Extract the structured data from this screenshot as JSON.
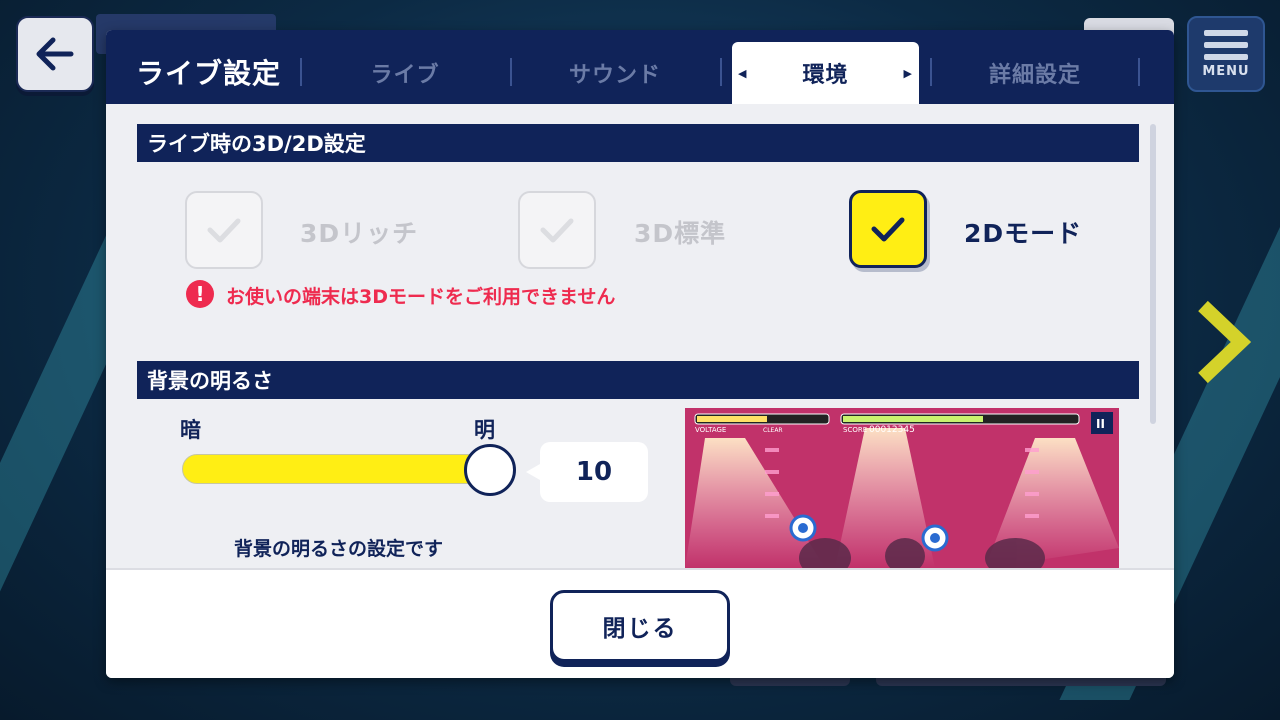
{
  "header": {
    "title": "ライブ設定",
    "tabs": [
      {
        "label": "ライブ",
        "active": false
      },
      {
        "label": "サウンド",
        "active": false
      },
      {
        "label": "環境",
        "active": true
      },
      {
        "label": "詳細設定",
        "active": false
      }
    ],
    "active_tab_left_arrow": "◀",
    "active_tab_right_arrow": "▶"
  },
  "menu_button": {
    "label": "MENU"
  },
  "section_render": {
    "title": "ライブ時の3D/2D設定",
    "options": [
      {
        "label": "3Dリッチ",
        "checked": false,
        "enabled": false
      },
      {
        "label": "3D標準",
        "checked": false,
        "enabled": false
      },
      {
        "label": "2Dモード",
        "checked": true,
        "enabled": true
      }
    ],
    "warning": "お使いの端末は3Dモードをご利用できません",
    "warning_icon": "!"
  },
  "section_brightness": {
    "title": "背景の明るさ",
    "min_label": "暗",
    "max_label": "明",
    "value": "10",
    "slider_fraction": 1.0,
    "description": "背景の明るさの設定です"
  },
  "preview": {
    "voltage_label": "VOLTAGE",
    "clear_label": "CLEAR",
    "score_label": "SCORE",
    "score_value": "00012345",
    "pause_icon": "II"
  },
  "footer": {
    "close_label": "閉じる"
  },
  "colors": {
    "navy": "#102359",
    "accent_yellow": "#ffee14",
    "warning_red": "#ee2b4f"
  }
}
